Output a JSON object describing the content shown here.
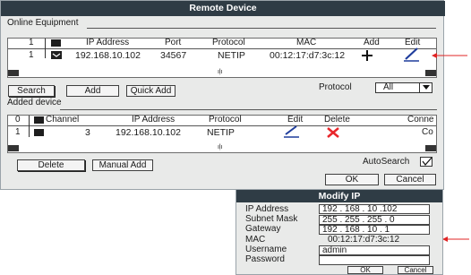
{
  "main": {
    "title": "Remote Device",
    "online_section": "Online Equipment",
    "online_headers": {
      "index": "1",
      "ip": "IP Address",
      "port": "Port",
      "protocol": "Protocol",
      "mac": "MAC",
      "add": "Add",
      "edit": "Edit"
    },
    "online_row": {
      "index": "1",
      "ip": "192.168.10.102",
      "port": "34567",
      "protocol": "NETIP",
      "mac": "00:12:17:d7:3c:12"
    },
    "buttons": {
      "search": "Search",
      "add": "Add",
      "quick_add": "Quick Add"
    },
    "protocol_label": "Protocol",
    "protocol_value": "All",
    "added_section": "Added device",
    "added_headers": {
      "index": "0",
      "channel": "Channel",
      "ip": "IP Address",
      "protocol": "Protocol",
      "edit": "Edit",
      "delete": "Delete",
      "connect": "Conne"
    },
    "added_row": {
      "index": "1",
      "channel": "3",
      "ip": "192.168.10.102",
      "protocol": "NETIP",
      "connect": "Co"
    },
    "delete_label": "Delete",
    "manual_add_label": "Manual Add",
    "autosearch_label": "AutoSearch",
    "autosearch_checked": true,
    "ok_label": "OK",
    "cancel_label": "Cancel"
  },
  "modify": {
    "title": "Modify IP",
    "labels": {
      "ip": "IP Address",
      "subnet": "Subnet Mask",
      "gateway": "Gateway",
      "mac": "MAC",
      "username": "Username",
      "password": "Password"
    },
    "values": {
      "ip": "192 . 168 . 10 .102",
      "subnet": "255 . 255 . 255 . 0",
      "gateway": "192 . 168 . 10  . 1",
      "mac": "00:12:17:d7:3c:12",
      "username": "admin",
      "password": ""
    },
    "ok_label": "OK",
    "cancel_label": "Cancel"
  },
  "colors": {
    "titlebar": "#2f3c45",
    "delete_x": "#e8262b",
    "pen": "#1f3d9c",
    "arrow": "#e02424"
  },
  "icons": {
    "add": "plus-icon",
    "edit": "pencil-icon",
    "delete": "x-icon",
    "scroll": "scroll-grip-icon",
    "annotation": "arrow-icon"
  }
}
